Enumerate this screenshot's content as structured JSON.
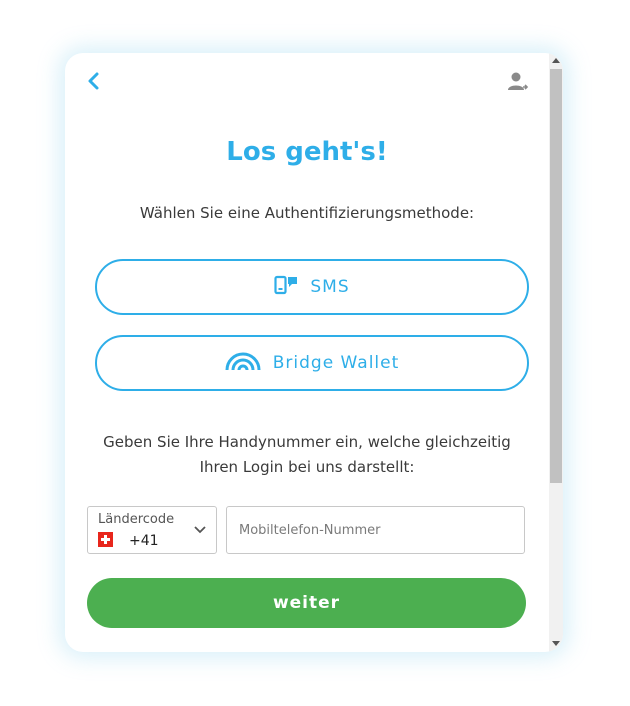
{
  "header": {
    "back_icon": "chevron-left-icon",
    "user_icon": "user-login-icon"
  },
  "title": "Los geht's!",
  "subtitle": "Wählen Sie eine Authentifizierungsmethode:",
  "methods": [
    {
      "label": "SMS",
      "icon": "phone-sms-icon"
    },
    {
      "label": "Bridge Wallet",
      "icon": "bridge-wallet-icon"
    }
  ],
  "info": {
    "line1": "Geben Sie Ihre Handynummer ein, welche gleichzeitig",
    "line2": "Ihren Login bei uns darstellt:"
  },
  "country": {
    "caption": "Ländercode",
    "flag": "swiss-flag-icon",
    "code": "+41"
  },
  "phone": {
    "placeholder": "Mobiltelefon-Nummer",
    "value": ""
  },
  "submit_label": "weiter",
  "colors": {
    "accent": "#2eaee8",
    "submit": "#4caf50"
  }
}
